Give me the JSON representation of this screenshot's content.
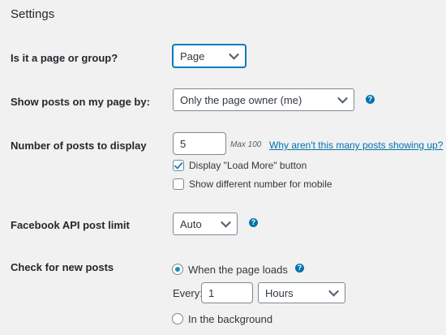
{
  "section": {
    "title": "Settings"
  },
  "page_or_group": {
    "label": "Is it a page or group?",
    "selected": "Page"
  },
  "show_posts_by": {
    "label": "Show posts on my page by:",
    "selected": "Only the page owner (me)",
    "help_icon": "help-icon"
  },
  "num_posts": {
    "label": "Number of posts to display",
    "value": "5",
    "max_note": "Max 100",
    "link_text": "Why aren't this many posts showing up?",
    "load_more_label": "Display \"Load More\" button",
    "load_more_checked": true,
    "mobile_label": "Show different number for mobile",
    "mobile_checked": false
  },
  "api_limit": {
    "label": "Facebook API post limit",
    "selected": "Auto",
    "help_icon": "help-icon"
  },
  "new_posts": {
    "label": "Check for new posts",
    "option_page_loads": "When the page loads",
    "option_page_loads_selected": true,
    "every_label": "Every:",
    "every_value": "1",
    "every_unit": "Hours",
    "option_background": "In the background",
    "option_background_selected": false,
    "help_icon": "help-icon"
  },
  "colors": {
    "accent": "#0073aa",
    "background": "#f1f1f1"
  }
}
